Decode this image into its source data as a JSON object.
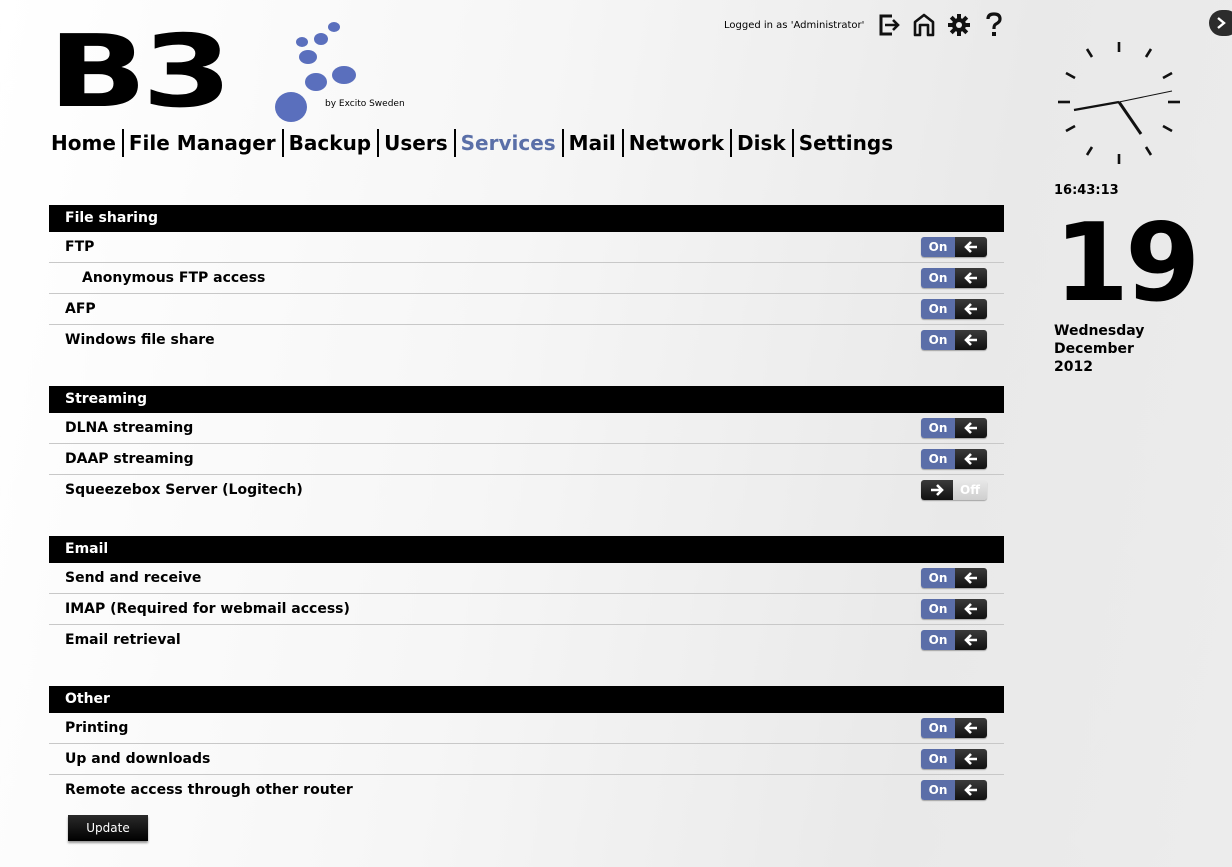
{
  "header": {
    "login_text": "Logged in as 'Administrator'",
    "icons": [
      "logout-icon",
      "home-icon",
      "gear-icon",
      "help-icon"
    ]
  },
  "logo": {
    "text": "B3",
    "subtitle": "by Excito Sweden",
    "dot_color": "#5a6fbd"
  },
  "nav": {
    "items": [
      {
        "label": "Home"
      },
      {
        "label": "File Manager"
      },
      {
        "label": "Backup"
      },
      {
        "label": "Users"
      },
      {
        "label": "Services",
        "active": true
      },
      {
        "label": "Mail"
      },
      {
        "label": "Network"
      },
      {
        "label": "Disk"
      },
      {
        "label": "Settings"
      }
    ],
    "active_color": "#5a6fa8"
  },
  "groups": [
    {
      "title": "File sharing",
      "rows": [
        {
          "label": "FTP",
          "state": "On"
        },
        {
          "label": "Anonymous FTP access",
          "state": "On",
          "indent": true
        },
        {
          "label": "AFP",
          "state": "On"
        },
        {
          "label": "Windows file share",
          "state": "On"
        }
      ]
    },
    {
      "title": "Streaming",
      "rows": [
        {
          "label": "DLNA streaming",
          "state": "On"
        },
        {
          "label": "DAAP streaming",
          "state": "On"
        },
        {
          "label": "Squeezebox Server (Logitech)",
          "state": "Off"
        }
      ]
    },
    {
      "title": "Email",
      "rows": [
        {
          "label": "Send and receive",
          "state": "On"
        },
        {
          "label": "IMAP (Required for webmail access)",
          "state": "On"
        },
        {
          "label": "Email retrieval",
          "state": "On"
        }
      ]
    },
    {
      "title": "Other",
      "rows": [
        {
          "label": "Printing",
          "state": "On"
        },
        {
          "label": "Up and downloads",
          "state": "On"
        },
        {
          "label": "Remote access through other router",
          "state": "On"
        }
      ]
    }
  ],
  "update_label": "Update",
  "sidebar": {
    "time": "16:43:13",
    "day": "19",
    "weekday": "Wednesday",
    "month": "December",
    "year": "2012"
  },
  "colors": {
    "toggle_on": "#5b6ea8",
    "header_bg": "#000000"
  }
}
